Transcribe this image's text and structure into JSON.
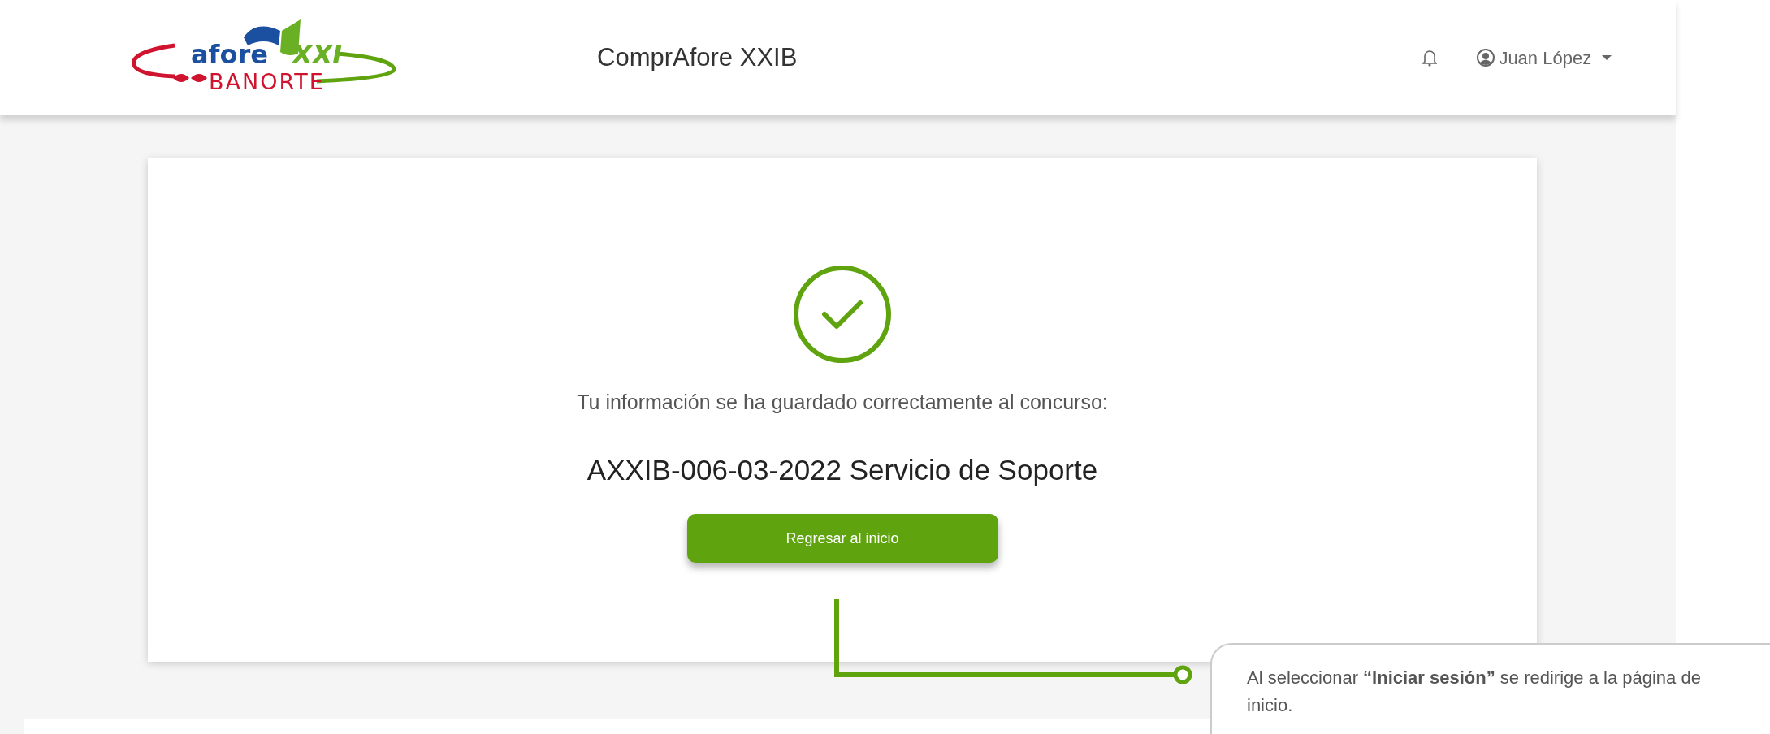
{
  "logo": {
    "texts": [
      "afore",
      "XXI",
      "BANORTE"
    ]
  },
  "app_title": "ComprAfore XXIB",
  "user": {
    "name": "Juan López"
  },
  "confirmation": {
    "message": "Tu información se ha guardado correctamente al concurso:",
    "contest": "AXXIB-006-03-2022 Servicio de Soporte",
    "button": "Regresar al inicio"
  },
  "annotation": {
    "text": "Al seleccionar **“Iniciar sesión”** se redirige a la página de inicio."
  }
}
